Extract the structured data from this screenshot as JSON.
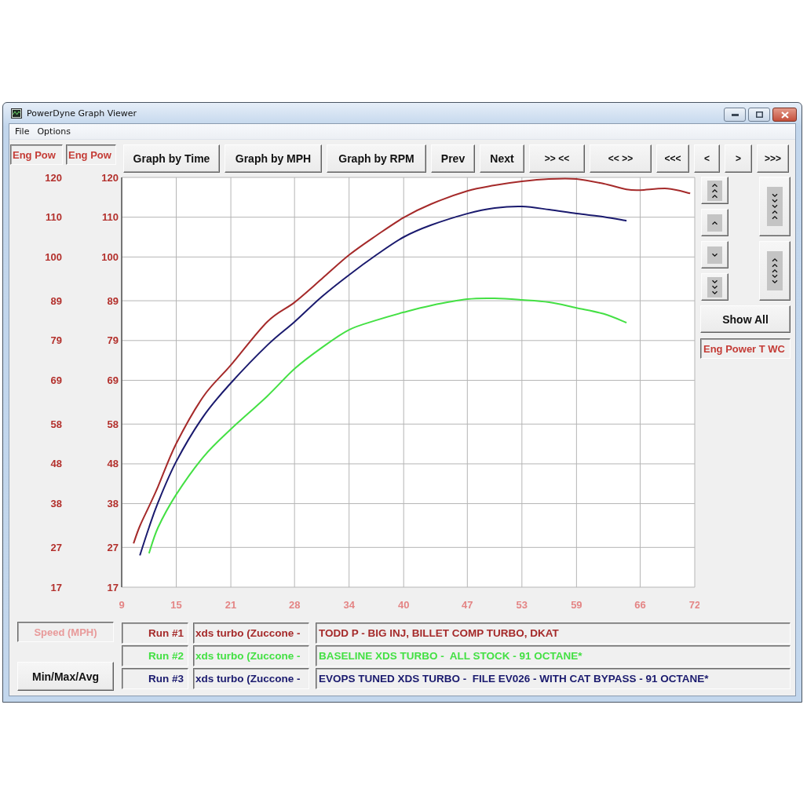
{
  "window": {
    "title": "PowerDyne Graph Viewer"
  },
  "menu": [
    "File",
    "Options"
  ],
  "toolbar": [
    "Graph by Time",
    "Graph by MPH",
    "Graph by RPM",
    "Prev",
    "Next",
    ">> <<",
    "<< >>",
    "<<<",
    "<",
    ">",
    ">>>"
  ],
  "graph": {
    "secondary_axis": {
      "title": "Eng Pow",
      "ticks": [
        "120",
        "110",
        "100",
        "89",
        "79",
        "69",
        "58",
        "48",
        "38",
        "27",
        "17"
      ]
    },
    "chart_data": {
      "type": "line",
      "xlabel": "Speed (MPH)",
      "ylabel": "Eng Pow",
      "x": [
        10.3,
        11,
        12,
        13,
        15,
        18,
        21,
        25,
        28,
        31,
        34,
        37,
        40,
        43,
        47,
        50,
        53,
        56,
        59,
        62,
        64.5,
        66,
        69,
        71.5
      ],
      "series": [
        {
          "name": "Run #1",
          "color": "#a52a2a",
          "values": [
            28,
            32.4,
            37.3,
            42.3,
            53.1,
            65,
            72.8,
            83.7,
            88.6,
            94.5,
            100.5,
            105.4,
            109.9,
            113.3,
            116.6,
            118,
            119,
            119.6,
            119.6,
            118.4,
            117,
            116.8,
            117.2,
            116
          ]
        },
        {
          "name": "Run #2",
          "color": "#44e044",
          "values": [
            null,
            null,
            25.5,
            32,
            40.3,
            49.8,
            56.7,
            65,
            71.9,
            77.2,
            81.7,
            84.1,
            86.1,
            87.8,
            89.4,
            89.6,
            89.2,
            88.6,
            87.2,
            85.7,
            83.5,
            null,
            null,
            null
          ]
        },
        {
          "name": "Run #3",
          "color": "#1a1a6e",
          "values": [
            null,
            25,
            32,
            38.3,
            48.6,
            60,
            68.3,
            77.8,
            83.7,
            90,
            95.5,
            100.5,
            105,
            108,
            110.9,
            112.3,
            112.7,
            111.9,
            110.9,
            110.1,
            109.1,
            null,
            null,
            null
          ]
        }
      ],
      "xlim": [
        9,
        72
      ],
      "ylim": [
        17,
        120
      ],
      "xticks": [
        9,
        15,
        21,
        28,
        34,
        40,
        47,
        53,
        59,
        66,
        72
      ],
      "yticks": [
        17,
        27,
        38,
        48,
        58,
        69,
        79,
        89,
        100,
        110,
        120
      ],
      "grid": true
    }
  },
  "side_panel": {
    "button": "Show All",
    "channel": "Eng Power T WC"
  },
  "min_max_button": "Min/Max/Avg",
  "runs": [
    {
      "file": "xds turbo (Zuccone -",
      "description": "TODD P - BIG INJ, BILLET COMP TURBO, DKAT"
    },
    {
      "file": "xds turbo (Zuccone -",
      "description": "BASELINE XDS TURBO -  ALL STOCK - 91 OCTANE*"
    },
    {
      "file": "xds turbo (Zuccone -",
      "description": "EVOPS TUNED XDS TURBO -  FILE EV026 - WITH CAT BYPASS - 91 OCTANE*"
    }
  ]
}
